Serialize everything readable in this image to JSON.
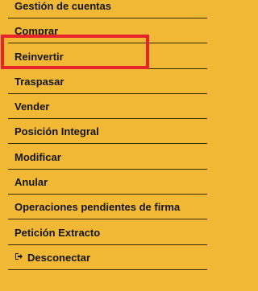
{
  "menu": {
    "items": [
      {
        "label": "Gestión de cuentas"
      },
      {
        "label": "Comprar"
      },
      {
        "label": "Reinvertir"
      },
      {
        "label": "Traspasar"
      },
      {
        "label": "Vender"
      },
      {
        "label": "Posición Integral"
      },
      {
        "label": "Modificar"
      },
      {
        "label": "Anular"
      },
      {
        "label": "Operaciones pendientes de firma"
      },
      {
        "label": "Petición Extracto"
      },
      {
        "label": "Desconectar",
        "icon": "sign-out-icon"
      }
    ]
  },
  "colors": {
    "background": "#f0b834",
    "highlight": "#e8242b",
    "text": "#141414",
    "divider": "#3a2a0a"
  }
}
